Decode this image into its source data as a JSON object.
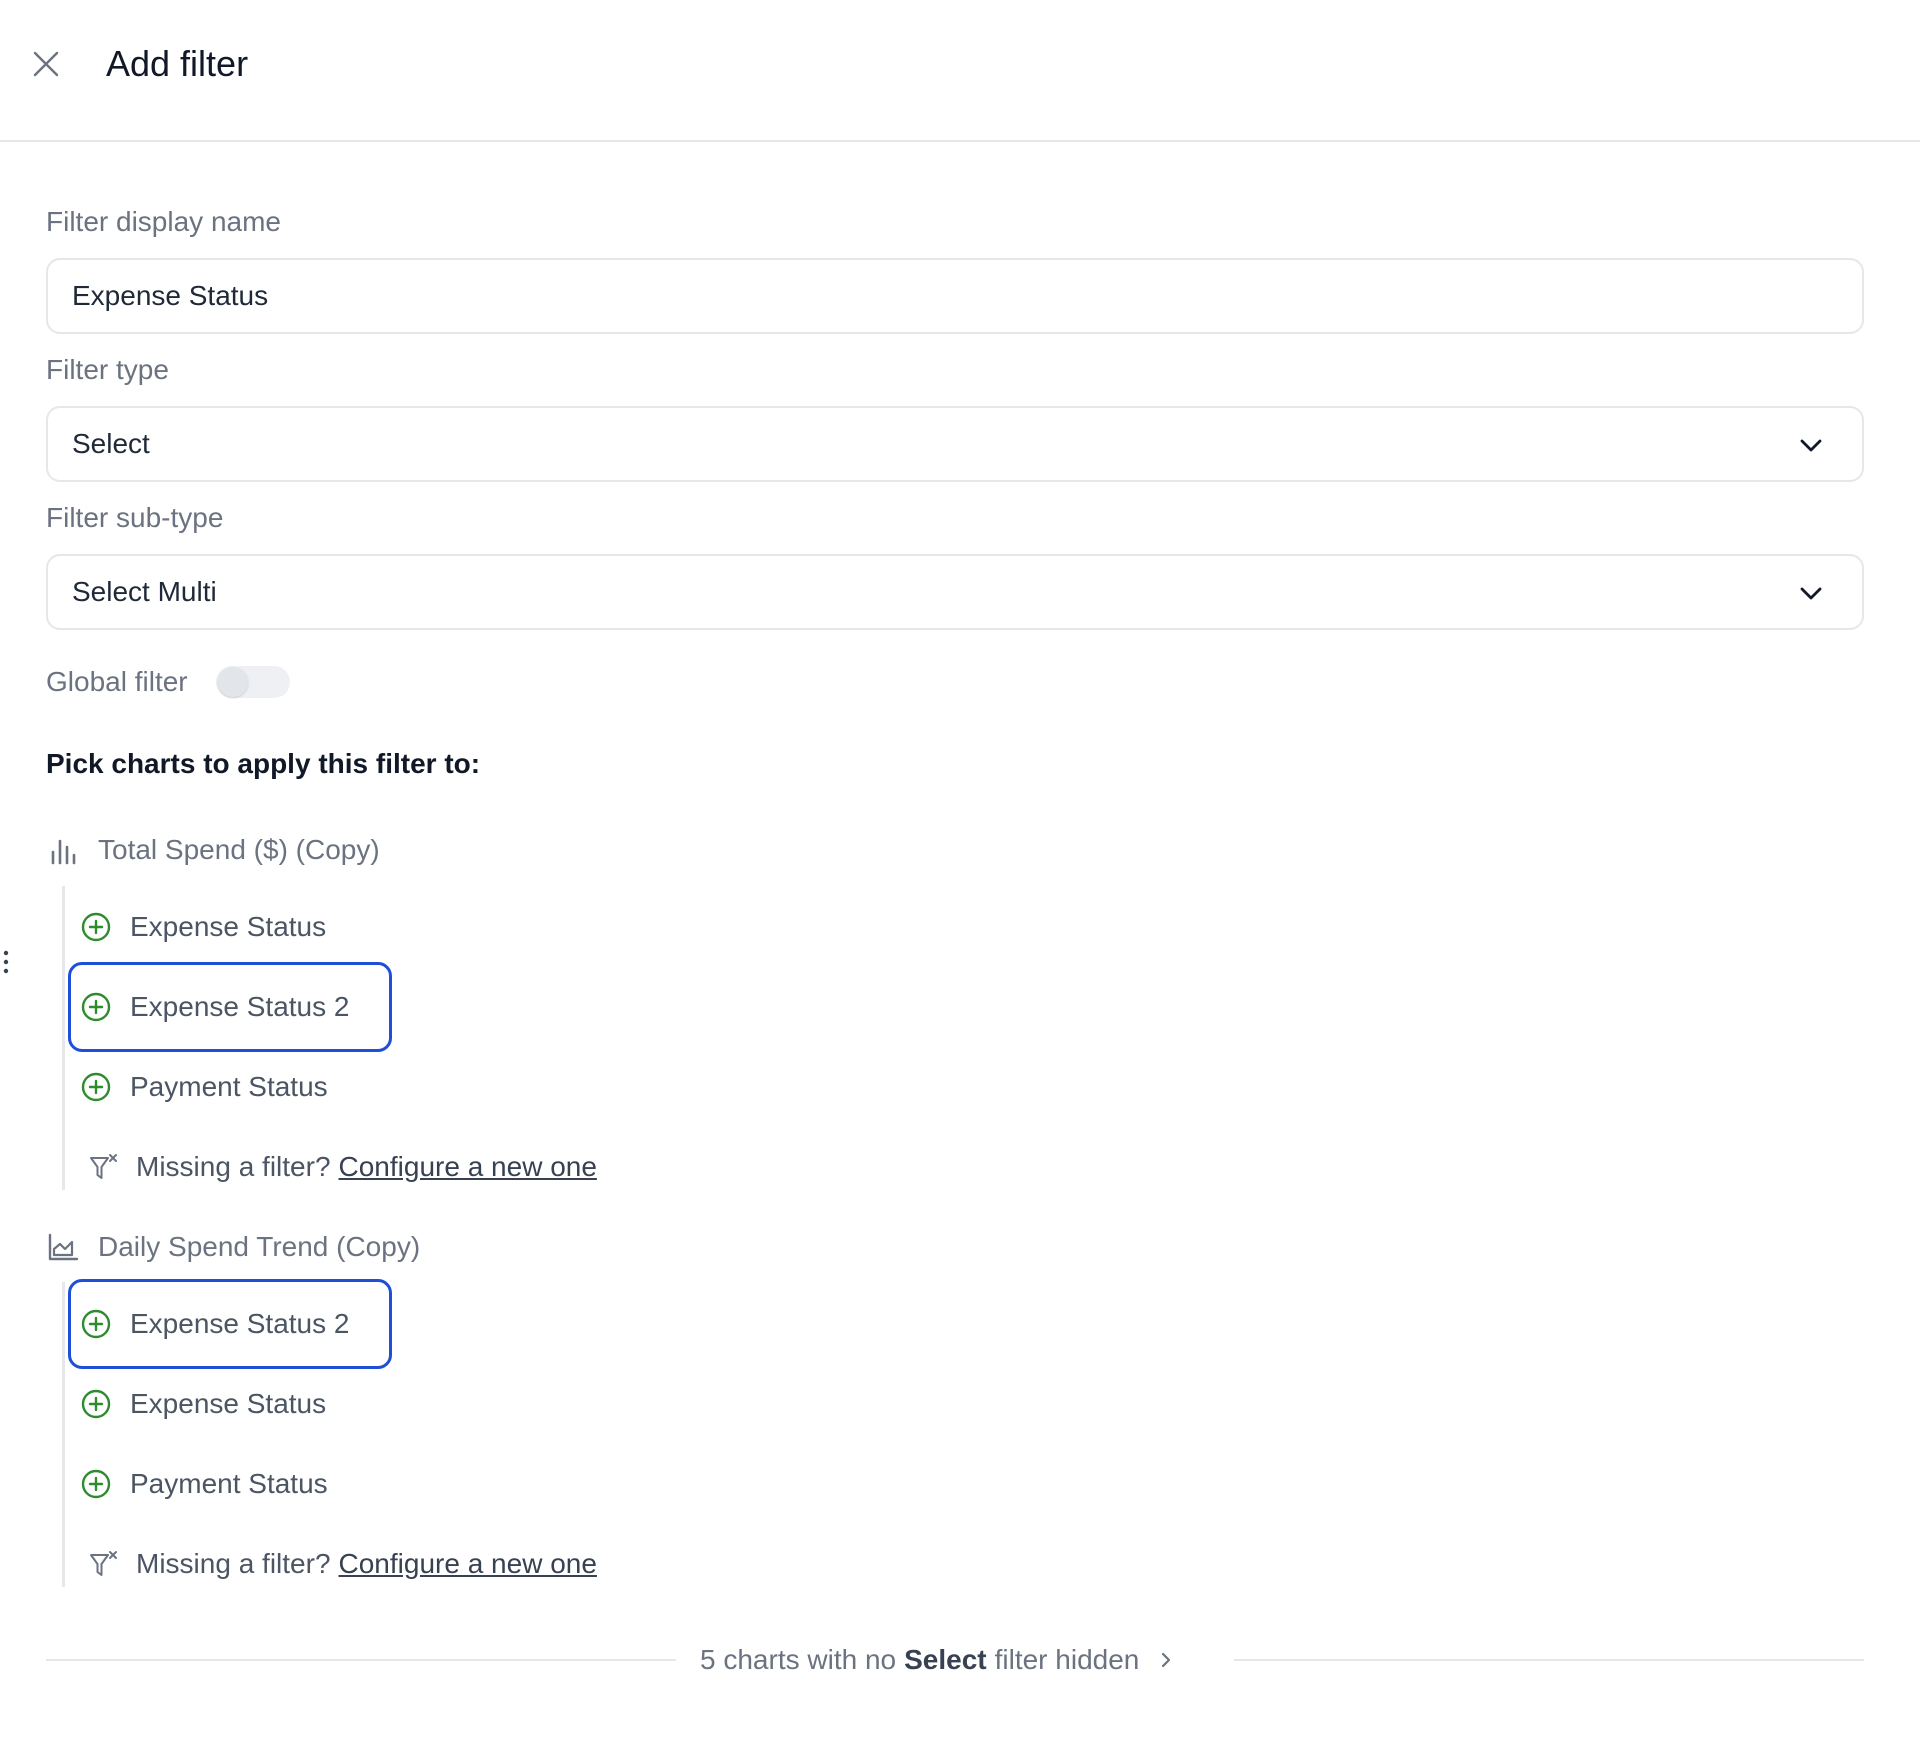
{
  "header": {
    "title": "Add filter"
  },
  "form": {
    "display_name_label": "Filter display name",
    "display_name_value": "Expense Status",
    "type_label": "Filter type",
    "type_value": "Select",
    "subtype_label": "Filter sub-type",
    "subtype_value": "Select Multi",
    "global_label": "Global filter",
    "global_enabled": false
  },
  "charts_section": {
    "title": "Pick charts to apply this filter to:",
    "charts": [
      {
        "name": "Total Spend ($) (Copy)",
        "icon": "bar-chart-icon",
        "filters": [
          "Expense Status",
          "Expense Status 2",
          "Payment Status"
        ],
        "missing_text": "Missing a filter?",
        "missing_link": "Configure a new one"
      },
      {
        "name": "Daily Spend Trend (Copy)",
        "icon": "area-chart-icon",
        "filters": [
          "Expense Status 2",
          "Expense Status",
          "Payment Status"
        ],
        "missing_text": "Missing a filter?",
        "missing_link": "Configure a new one"
      }
    ]
  },
  "footer": {
    "prefix": "5 charts with no",
    "bold": "Select",
    "suffix": "filter hidden"
  },
  "colors": {
    "accent_green": "#2e8b2e",
    "highlight_blue": "#1f4fd8"
  }
}
